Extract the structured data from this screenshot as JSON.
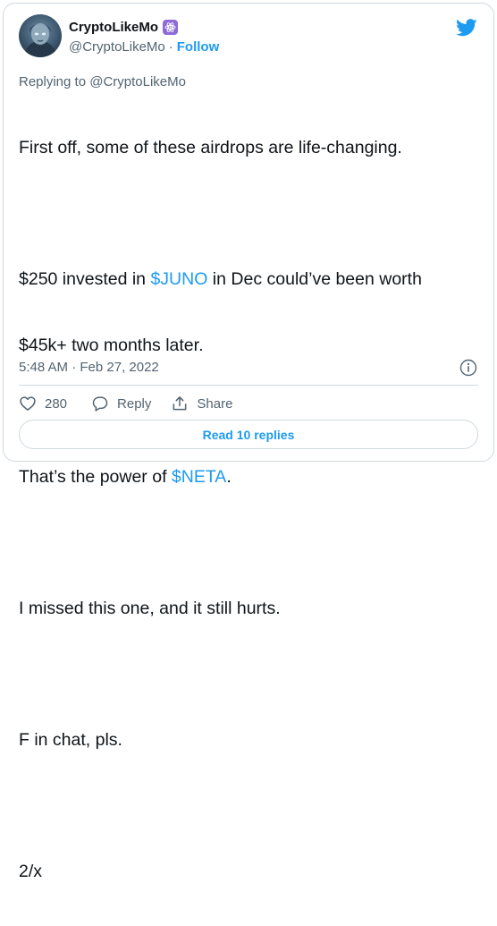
{
  "author": {
    "name": "CryptoLikeMo",
    "handle": "@CryptoLikeMo",
    "separator": "·",
    "follow_label": "Follow",
    "badge_icon": "atom-icon"
  },
  "replying_to": "Replying to @CryptoLikeMo",
  "tweet": {
    "line1": "First off, some of these airdrops are life-changing.",
    "p2_a": "$250 invested in ",
    "p2_cashtag": "$JUNO",
    "p2_b": " in Dec could’ve been worth",
    "p2_c": "$45k+ two months later.",
    "p3_a": "That’s the power of ",
    "p3_cashtag": "$NETA",
    "p3_b": ".",
    "line4": "I missed this one, and it still hurts.",
    "line5": "F in chat, pls.",
    "line6": "2/x"
  },
  "timestamp": "5:48 AM · Feb 27, 2022",
  "actions": {
    "like_count": "280",
    "reply_label": "Reply",
    "share_label": "Share"
  },
  "read_replies_label": "Read 10 replies",
  "colors": {
    "accent": "#1d9bf0",
    "muted": "#536471",
    "border": "#cfd9de",
    "badge": "#8d6ad8"
  }
}
